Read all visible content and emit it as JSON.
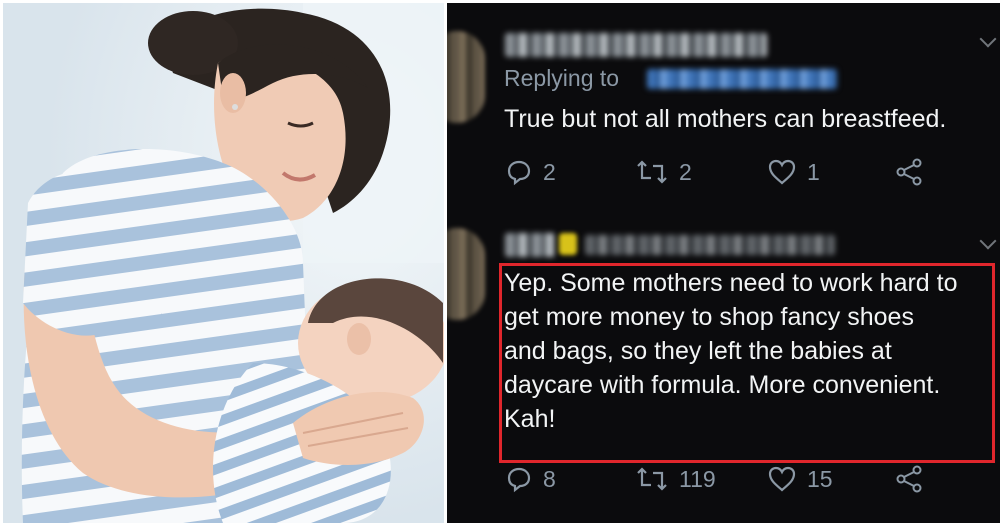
{
  "left_image": {
    "subject": "mother breastfeeding baby photo"
  },
  "tweets": [
    {
      "reply_prefix": "Replying to",
      "text": "True but not all mothers can breastfeed.",
      "actions": {
        "replies": "2",
        "retweets": "2",
        "likes": "1"
      }
    },
    {
      "text": "Yep. Some mothers need to work hard to\nget more money to shop fancy shoes\nand bags, so they left the babies at\ndaycare with formula. More convenient.\nKah!",
      "actions": {
        "replies": "8",
        "retweets": "119",
        "likes": "15"
      },
      "highlighted": true
    }
  ],
  "colors": {
    "background": "#0b0b0d",
    "text": "#f2f4f5",
    "muted": "#8b98a5",
    "highlight_border": "#e0262c"
  },
  "icons": [
    "reply-icon",
    "retweet-icon",
    "like-icon",
    "share-icon",
    "chevron-down-icon"
  ]
}
